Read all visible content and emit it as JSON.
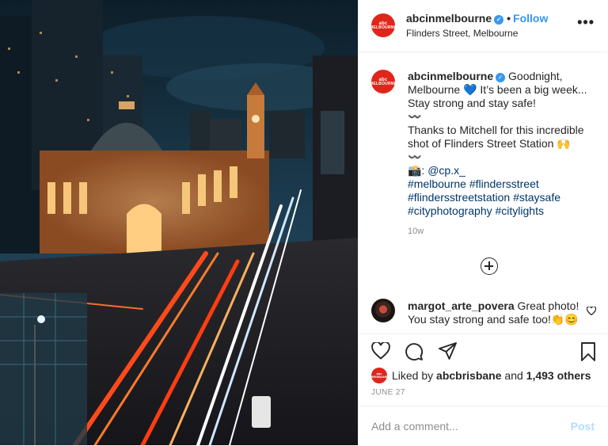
{
  "account": {
    "username": "abcinmelbourne",
    "avatar_text": "MELBOURNE",
    "avatar_abc": "abc",
    "verified": true,
    "follow_label": "Follow",
    "location": "Flinders Street, Melbourne"
  },
  "caption": {
    "username": "abcinmelbourne",
    "lines": [
      "Goodnight, Melbourne 💙 It’s been a big week... Stay strong and stay safe!",
      "〰️",
      "Thanks to Mitchell for this incredible shot of Flinders Street Station 🙌",
      "〰️"
    ],
    "photo_credit_prefix": "📸: ",
    "photo_credit": "@cp.x_",
    "hashtags": "#melbourne #flindersstreet #flindersstreetstation #staysafe #cityphotography #citylights",
    "time": "10w"
  },
  "comment": {
    "username": "margot_arte_povera",
    "text": "Great photo! You stay strong and safe too!👏😊"
  },
  "likes": {
    "prefix": "Liked by",
    "user": "abcbrisbane",
    "middle": "and",
    "others": "1,493 others",
    "avatar_text": "BRISBANE",
    "avatar_abc": "abc"
  },
  "date": "JUNE 27",
  "add_comment": {
    "placeholder": "Add a comment...",
    "post_label": "Post"
  },
  "colors": {
    "brand_red": "#e0251b",
    "link_blue": "#3897f0",
    "post_disabled": "#b2dffc"
  },
  "icons": [
    "more-icon",
    "verified-icon",
    "plus-circle-icon",
    "heart-icon",
    "comment-icon",
    "share-icon",
    "bookmark-icon"
  ]
}
